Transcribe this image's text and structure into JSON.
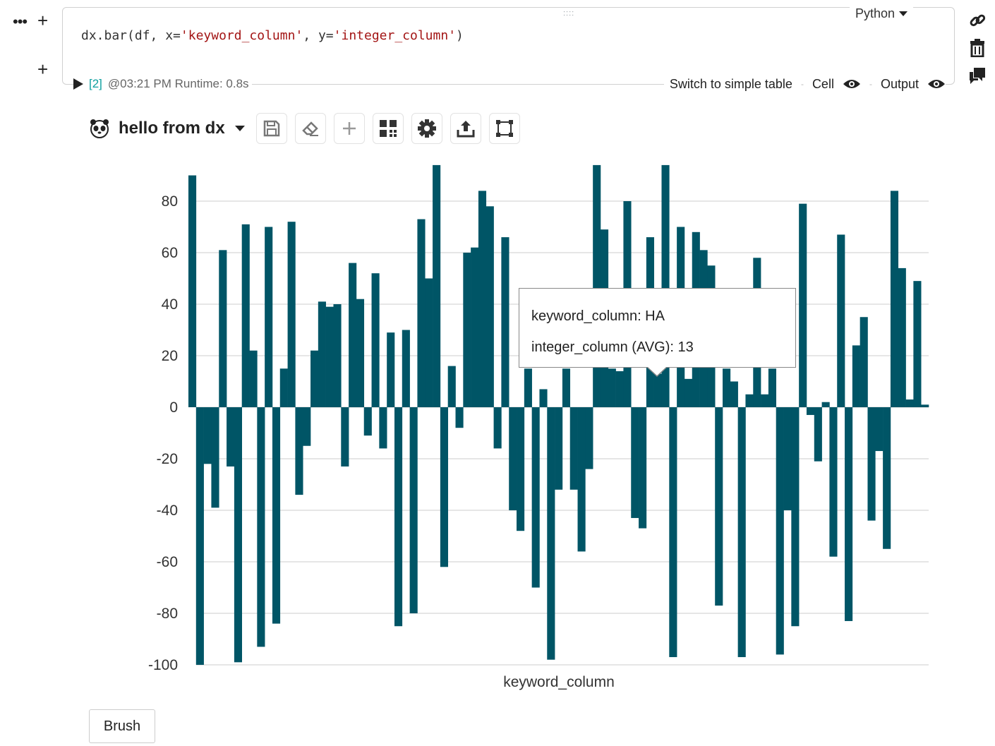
{
  "cell": {
    "language": "Python",
    "code_prefix": "dx.bar(df, x=",
    "code_arg1": "'keyword_column'",
    "code_mid": ", y=",
    "code_arg2": "'integer_column'",
    "code_suffix": ")",
    "exec_count": "[2]",
    "exec_info": "@03:21 PM Runtime: 0.8s",
    "switch_label": "Switch to simple table",
    "cell_label": "Cell",
    "output_label": "Output"
  },
  "toolbar": {
    "title": "hello from dx",
    "buttons": [
      "save-icon",
      "eraser-icon",
      "plus-icon",
      "widget-icon",
      "gear-icon",
      "export-icon",
      "resize-icon"
    ]
  },
  "tooltip": {
    "line1": "keyword_column: HA",
    "line2": "integer_column (AVG): 13"
  },
  "brush_label": "Brush",
  "colors": {
    "bar": "#005566",
    "accent": "#0fa0a0"
  },
  "chart_data": {
    "type": "bar",
    "xlabel": "keyword_column",
    "ylabel": "",
    "ylim": [
      -100,
      90
    ],
    "yticks": [
      80,
      60,
      40,
      20,
      0,
      -20,
      -40,
      -60,
      -80,
      -100
    ],
    "grid": true,
    "values": [
      90,
      -100,
      -22,
      -39,
      61,
      -23,
      -99,
      71,
      22,
      -93,
      70,
      -84,
      15,
      72,
      -34,
      -15,
      22,
      41,
      39,
      40,
      -23,
      56,
      42,
      -11,
      52,
      -16,
      29,
      -85,
      30,
      -80,
      73,
      50,
      94,
      -62,
      16,
      -8,
      60,
      62,
      84,
      78,
      -16,
      66,
      -40,
      -48,
      15,
      -70,
      7,
      -98,
      -32,
      15,
      -32,
      -56,
      -24,
      94,
      69,
      15,
      14,
      80,
      -43,
      -47,
      66,
      13,
      94,
      -97,
      70,
      11,
      68,
      61,
      55,
      -77,
      15,
      10,
      -97,
      5,
      58,
      5,
      15,
      -96,
      -40,
      -85,
      79,
      -3,
      -21,
      2,
      -58,
      67,
      -83,
      24,
      35,
      -44,
      -17,
      -55,
      84,
      54,
      3,
      49,
      1
    ]
  }
}
